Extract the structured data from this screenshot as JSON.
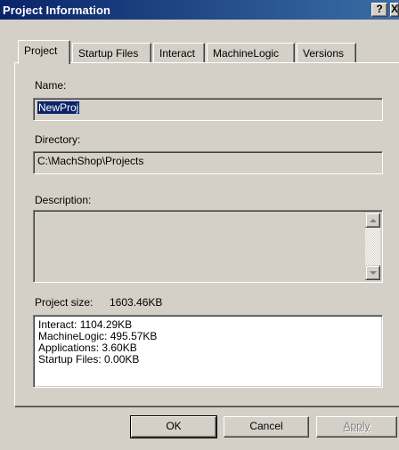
{
  "window": {
    "title": "Project Information",
    "help_label": "?",
    "close_label": "X"
  },
  "tabs": [
    {
      "label": "Project",
      "active": true
    },
    {
      "label": "Startup Files",
      "active": false
    },
    {
      "label": "Interact",
      "active": false
    },
    {
      "label": "MachineLogic",
      "active": false
    },
    {
      "label": "Versions",
      "active": false
    }
  ],
  "project": {
    "name_label": "Name:",
    "name_value": "NewProj",
    "directory_label": "Directory:",
    "directory_value": "C:\\MachShop\\Projects",
    "description_label": "Description:",
    "description_value": "",
    "size_label": "Project size:",
    "size_value": "1603.46KB",
    "size_breakdown": [
      "Interact: 1104.29KB",
      "MachineLogic: 495.57KB",
      "Applications: 3.60KB",
      "Startup Files: 0.00KB"
    ]
  },
  "buttons": {
    "ok": "OK",
    "cancel": "Cancel",
    "apply": "Apply"
  }
}
